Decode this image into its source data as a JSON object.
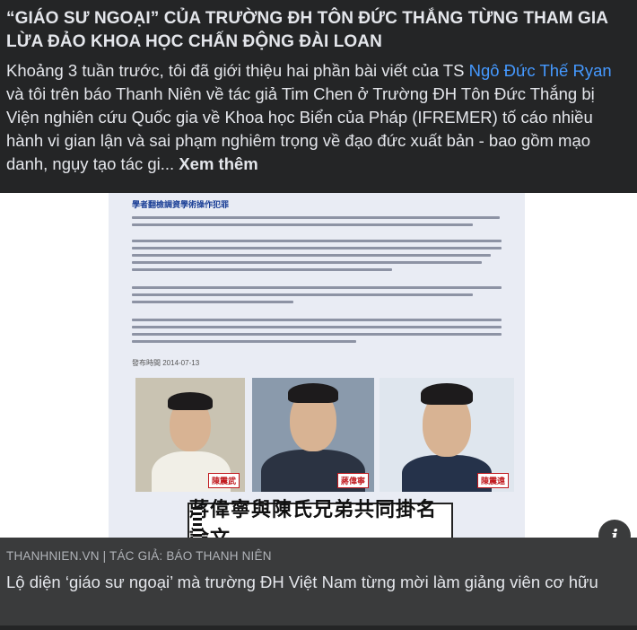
{
  "post": {
    "heading": "“GIÁO SƯ NGOẠI” CỦA TRƯỜNG ĐH TÔN ĐỨC THẮNG TỪNG THAM GIA LỪA ĐẢO KHOA HỌC CHẤN ĐỘNG ĐÀI LOAN",
    "body_before": "Khoảng 3 tuần trước, tôi đã giới thiệu hai phần bài viết của TS ",
    "mention": "Ngô Đức Thế Ryan",
    "body_after": " và tôi trên báo Thanh Niên về tác giả Tim Chen ở Trường ĐH Tôn Đức Thắng bị Viện nghiên cứu Quốc gia về Khoa học Biển của Pháp (IFREMER) tố cáo nhiều hành vi gian lận và sai phạm nghiêm trọng về đạo đức xuất bản - bao gồm mạo danh, ngụy tạo tác gi...",
    "see_more": "Xem thêm"
  },
  "media": {
    "scan_title": "學者翻檢調資學術操作犯罪",
    "date_text": "發布時間 2014-07-13",
    "photo_labels": [
      "陳震武",
      "蔣偉寧",
      "陳震遠"
    ],
    "banner_text": "蔣偉寧與陳氏兄弟共同掛名論文",
    "info_icon": "i"
  },
  "link_preview": {
    "domain": "THANHNIEN.VN | TÁC GIẢ: BÁO THANH NIÊN",
    "title": "Lộ diện ‘giáo sư ngoại’ mà trường ĐH Việt Nam từng mời làm giảng viên cơ hữu"
  },
  "colors": {
    "background": "#242526",
    "link_card": "#3a3b3c",
    "mention": "#4599ff"
  }
}
